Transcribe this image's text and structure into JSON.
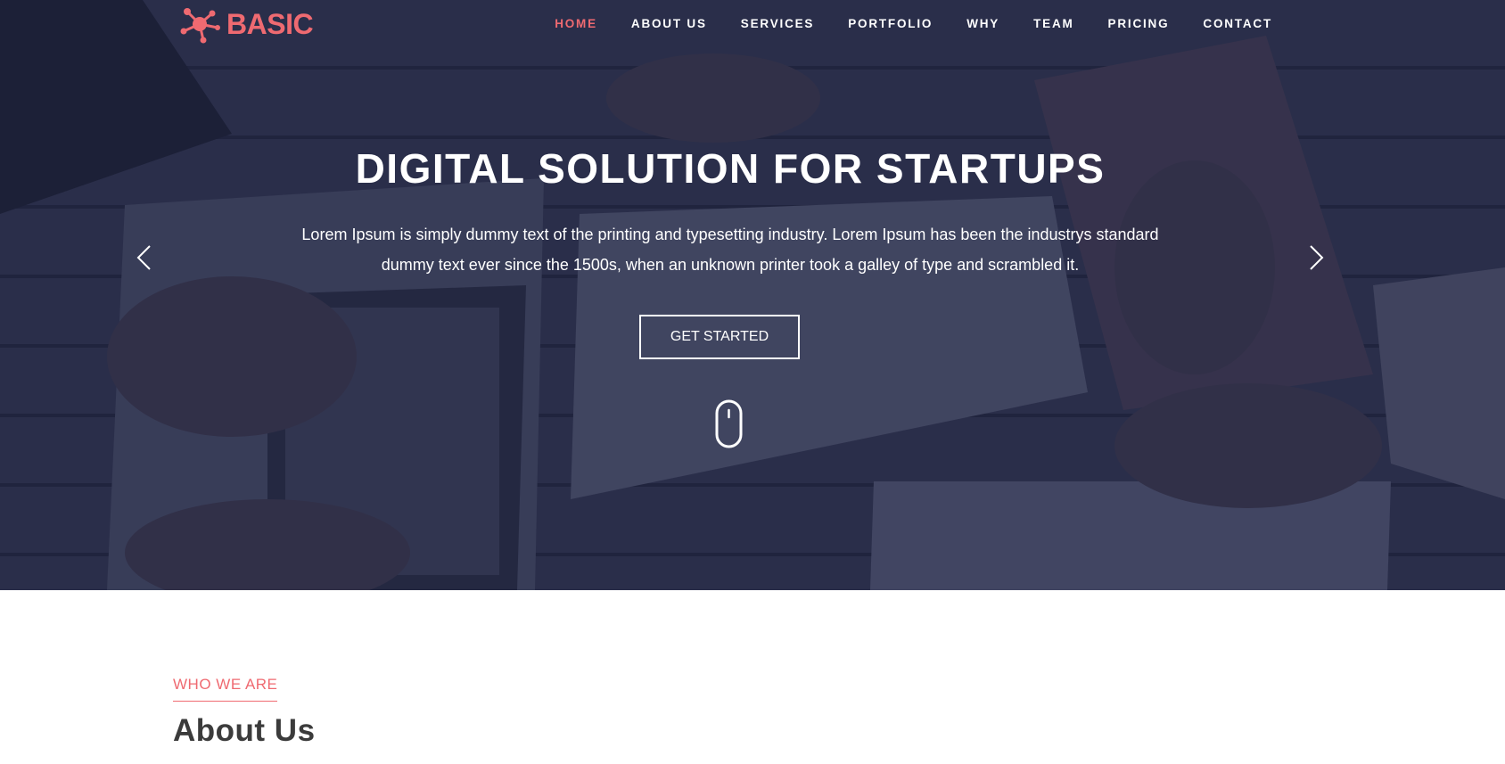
{
  "brand": {
    "name": "BASIC",
    "accent_color": "#ef6a71"
  },
  "nav": {
    "items": [
      {
        "label": "HOME",
        "active": true
      },
      {
        "label": "ABOUT US"
      },
      {
        "label": "SERVICES"
      },
      {
        "label": "PORTFOLIO"
      },
      {
        "label": "WHY"
      },
      {
        "label": "TEAM"
      },
      {
        "label": "PRICING"
      },
      {
        "label": "CONTACT"
      }
    ]
  },
  "hero": {
    "title": "DIGITAL SOLUTION FOR STARTUPS",
    "text_line1": "Lorem Ipsum is simply dummy text of the printing and typesetting industry. Lorem Ipsum has been the industrys standard",
    "text_line2": "dummy text ever since the 1500s, when an unknown printer took a galley of type and scrambled it.",
    "cta_label": "GET STARTED",
    "overlay_color": "#272c4a",
    "icons": {
      "prev": "chevron-left-icon",
      "next": "chevron-right-icon",
      "scroll": "mouse-scroll-icon"
    }
  },
  "about": {
    "eyebrow": "WHO WE ARE",
    "title": "About Us"
  }
}
